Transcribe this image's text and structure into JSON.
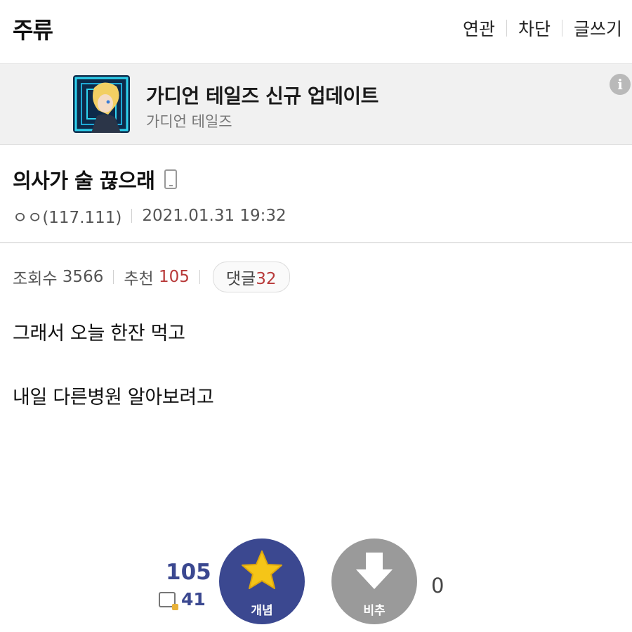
{
  "header": {
    "gallery_name": "주류",
    "links": [
      "연관",
      "차단",
      "글쓰기"
    ]
  },
  "ad": {
    "title": "가디언 테일즈 신규 업데이트",
    "subtitle": "가디언 테일즈",
    "info_icon": "i"
  },
  "post": {
    "title": "의사가 술 끊으래",
    "author": "ㅇㅇ(117.111)",
    "datetime": "2021.01.31 19:32"
  },
  "stats": {
    "views_label": "조회수",
    "views": "3566",
    "recommend_label": "추천",
    "recommend": "105",
    "comments_label": "댓글",
    "comments": "32"
  },
  "body": {
    "line1": "그래서 오늘 한잔 먹고",
    "line2": "내일 다른병원 알아보려고"
  },
  "vote": {
    "up_total": "105",
    "up_mobile": "41",
    "up_label": "개념",
    "down_label": "비추",
    "down_total": "0"
  },
  "colors": {
    "accent": "#3b4890",
    "highlight": "#b83a3a",
    "star": "#f5c518",
    "down_button": "#9a9a9a"
  }
}
